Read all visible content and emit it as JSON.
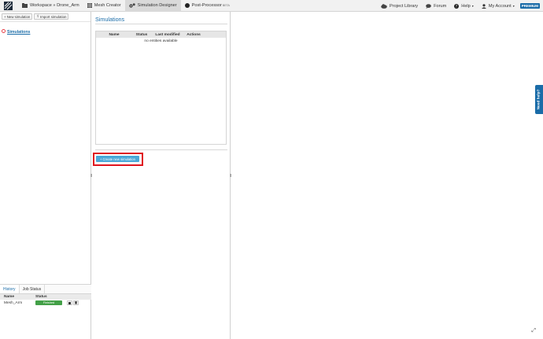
{
  "nav": {
    "workspace_label": "Workspace » Drone_Arm",
    "mesh_creator": "Mesh Creator",
    "simulation_designer": "Simulation Designer",
    "post_processor": "Post-Processor",
    "post_processor_badge": "BETA",
    "project_library": "Project Library",
    "forum": "Forum",
    "help": "Help",
    "my_account": "My Account",
    "premium": "PREMIUM"
  },
  "left": {
    "new_simulation": "New simulation",
    "import_simulation": "Import simulation",
    "tree_root": "Simulations"
  },
  "bottom": {
    "tabs": [
      "History",
      "Job Status"
    ],
    "columns": [
      "Name",
      "Status"
    ],
    "rows": [
      {
        "name": "Mesh_Arm",
        "status": "Finished"
      }
    ]
  },
  "middle": {
    "title": "Simulations",
    "columns": [
      "Name",
      "Status",
      "Last modified",
      "Actions"
    ],
    "empty_text": "no entities available",
    "create_button": "Create new simulation"
  },
  "right": {
    "need_help": "Need help?"
  },
  "colors": {
    "accent": "#1a6ca8",
    "create_button": "#4aa8d8",
    "highlight": "#e0141e",
    "status_finished": "#43a047"
  }
}
